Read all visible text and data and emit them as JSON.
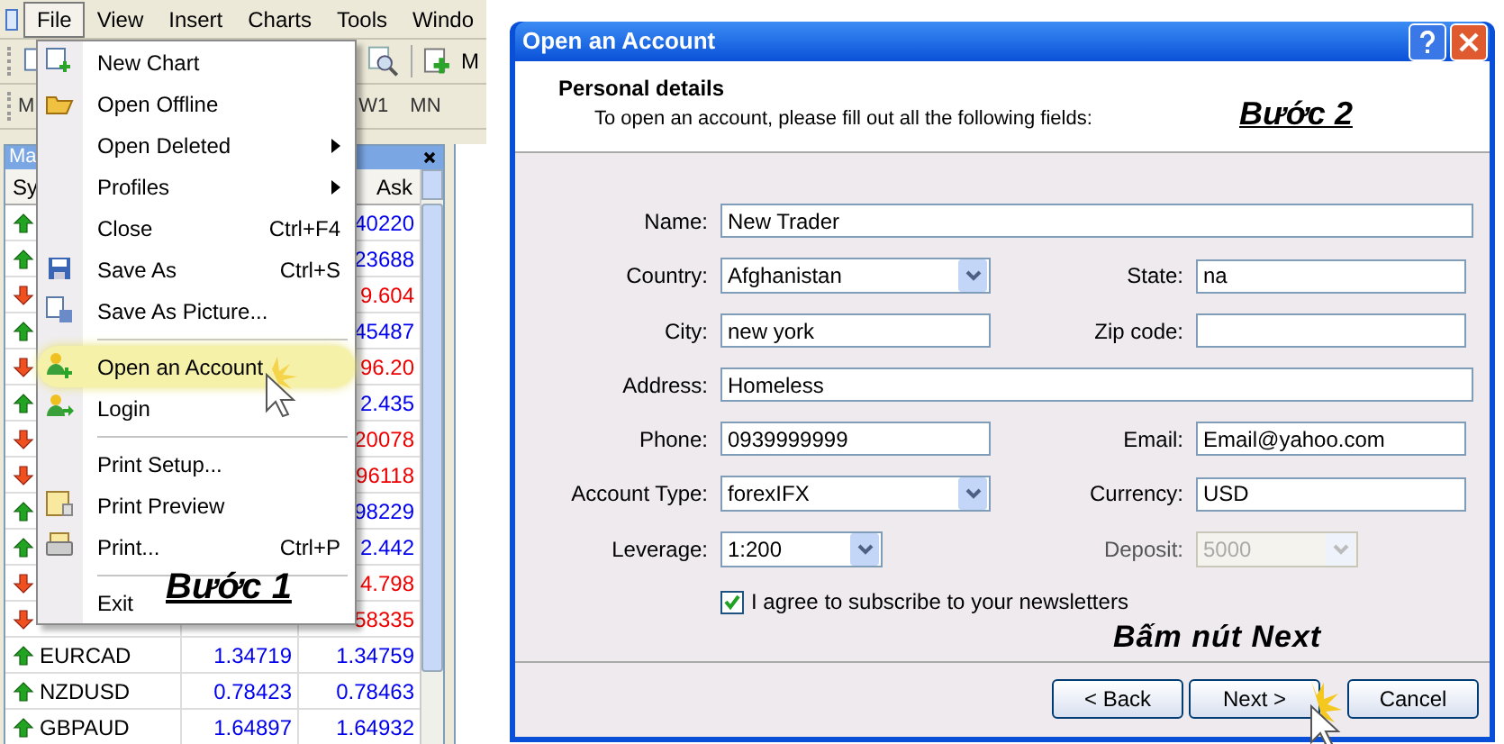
{
  "left": {
    "menubar": [
      {
        "label": "File",
        "selected": true
      },
      {
        "label": "View",
        "selected": false
      },
      {
        "label": "Insert",
        "selected": false
      },
      {
        "label": "Charts",
        "selected": false
      },
      {
        "label": "Tools",
        "selected": false
      },
      {
        "label": "Windo",
        "selected": false
      }
    ],
    "toolbar_label": "M",
    "timeframes": [
      "M",
      "W1",
      "MN"
    ],
    "market_watch": {
      "title": "Ma",
      "columns": [
        "Sy",
        "Ask"
      ],
      "rows": [
        {
          "up": true,
          "ask": "40220"
        },
        {
          "up": true,
          "ask": "23688"
        },
        {
          "up": false,
          "ask": "9.604"
        },
        {
          "up": true,
          "ask": "45487"
        },
        {
          "up": false,
          "ask": "96.20"
        },
        {
          "up": true,
          "ask": "2.435"
        },
        {
          "up": false,
          "ask": "20078"
        },
        {
          "up": false,
          "ask": "96118"
        },
        {
          "up": true,
          "ask": "98229"
        },
        {
          "up": true,
          "ask": "2.442"
        },
        {
          "up": false,
          "ask": "4.798"
        },
        {
          "up": false,
          "ask": "58335"
        },
        {
          "up": true,
          "symbol": "EURCAD",
          "bid": "1.34719",
          "ask": "1.34759"
        },
        {
          "up": true,
          "symbol": "NZDUSD",
          "bid": "0.78423",
          "ask": "0.78463"
        },
        {
          "up": true,
          "symbol": "GBPAUD",
          "bid": "1.64897",
          "ask": "1.64932"
        }
      ]
    },
    "file_menu": [
      {
        "kind": "item",
        "label": "New Chart",
        "submenu": false,
        "selected": false
      },
      {
        "kind": "item",
        "label": "Open Offline",
        "submenu": false,
        "selected": false
      },
      {
        "kind": "item",
        "label": "Open Deleted",
        "submenu": true,
        "selected": false
      },
      {
        "kind": "item",
        "label": "Profiles",
        "submenu": true,
        "selected": false
      },
      {
        "kind": "item",
        "label": "Close",
        "shortcut": "Ctrl+F4",
        "submenu": false,
        "selected": false
      },
      {
        "kind": "item",
        "label": "Save As",
        "shortcut": "Ctrl+S",
        "submenu": false,
        "selected": false
      },
      {
        "kind": "item",
        "label": "Save As Picture...",
        "submenu": false,
        "selected": false
      },
      {
        "kind": "separator"
      },
      {
        "kind": "item",
        "label": "Open an Account",
        "submenu": false,
        "selected": true
      },
      {
        "kind": "item",
        "label": "Login",
        "submenu": false,
        "selected": false
      },
      {
        "kind": "separator"
      },
      {
        "kind": "item",
        "label": "Print Setup...",
        "submenu": false,
        "selected": false
      },
      {
        "kind": "item",
        "label": "Print Preview",
        "submenu": false,
        "selected": false
      },
      {
        "kind": "item",
        "label": "Print...",
        "shortcut": "Ctrl+P",
        "submenu": false,
        "selected": false
      },
      {
        "kind": "separator"
      },
      {
        "kind": "item",
        "label": "Exit",
        "submenu": false,
        "selected": false
      }
    ],
    "annotation": "Bước 1"
  },
  "dialog": {
    "title": "Open an Account",
    "header": {
      "title": "Personal details",
      "subtitle": "To open an account, please fill out all the following fields:",
      "annotation": "Bước 2"
    },
    "rows": [
      {
        "fields": [
          {
            "label": "Name:",
            "value": "New Trader",
            "kind": "text",
            "disabled": false
          }
        ]
      },
      {
        "fields": [
          {
            "label": "Country:",
            "value": "Afghanistan",
            "kind": "dropdown",
            "disabled": false
          },
          {
            "label": "State:",
            "value": "na",
            "kind": "text",
            "disabled": false
          }
        ]
      },
      {
        "fields": [
          {
            "label": "City:",
            "value": "new york",
            "kind": "text",
            "disabled": false
          },
          {
            "label": "Zip code:",
            "kind": "text",
            "disabled": false
          }
        ]
      },
      {
        "fields": [
          {
            "label": "Address:",
            "value": "Homeless",
            "kind": "text",
            "disabled": false
          }
        ]
      },
      {
        "fields": [
          {
            "label": "Phone:",
            "value": "0939999999",
            "kind": "text",
            "disabled": false
          },
          {
            "label": "Email:",
            "value": "Email@yahoo.com",
            "kind": "text",
            "disabled": false
          }
        ]
      },
      {
        "fields": [
          {
            "label": "Account Type:",
            "value": "forexIFX",
            "kind": "dropdown",
            "disabled": false
          },
          {
            "label": "Currency:",
            "value": "USD",
            "kind": "text",
            "disabled": false
          }
        ]
      },
      {
        "fields": [
          {
            "label": "Leverage:",
            "value": "1:200",
            "kind": "short_dropdown",
            "disabled": false
          },
          {
            "label": "Deposit:",
            "value": "5000",
            "kind": "short_dropdown",
            "disabled": true
          }
        ]
      }
    ],
    "checkbox": {
      "label": "I agree to subscribe to your newsletters",
      "checked": true
    },
    "annotation": "Bấm nút Next",
    "buttons": [
      "< Back",
      "Next >",
      "Cancel"
    ]
  }
}
